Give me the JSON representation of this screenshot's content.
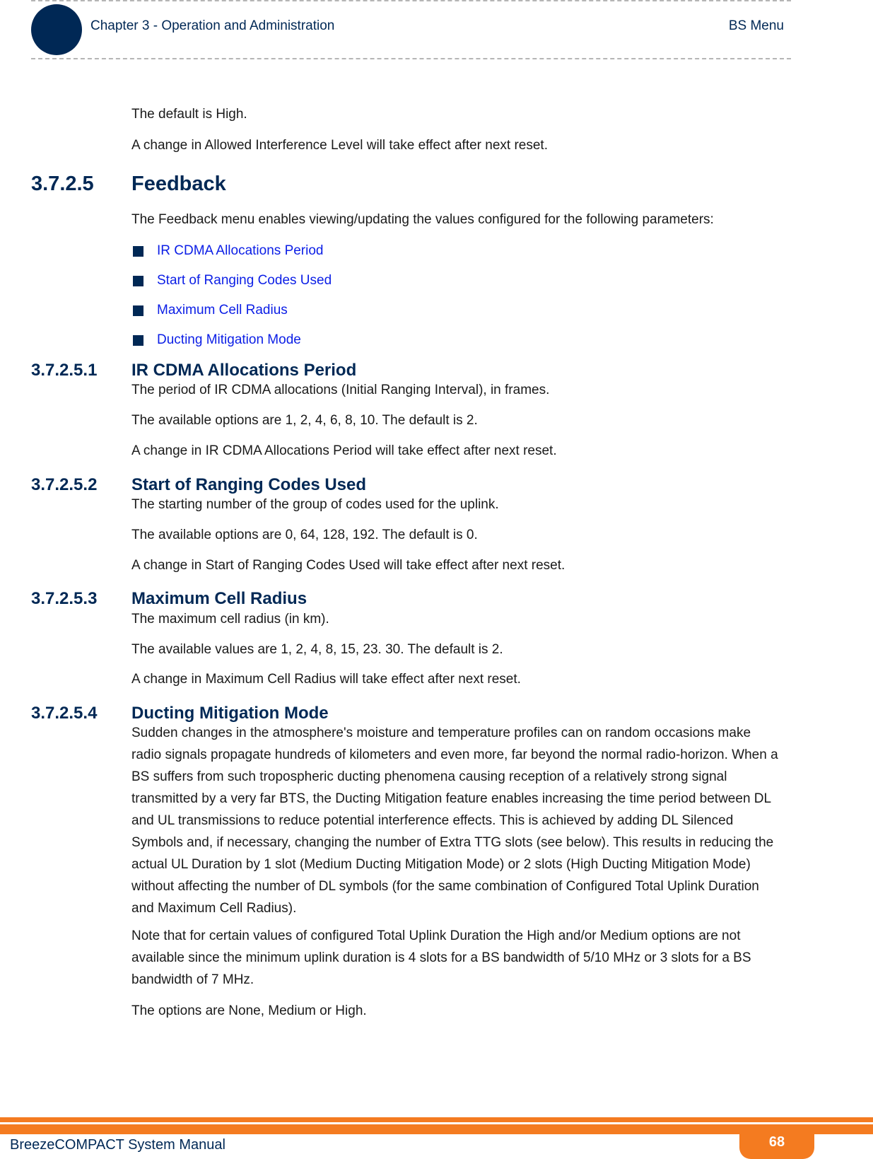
{
  "header": {
    "chapter": "Chapter 3 - Operation and Administration",
    "section": "BS Menu"
  },
  "intro": {
    "line1": "The default is High.",
    "line2": "A change in Allowed Interference Level will take effect after next reset."
  },
  "feedback": {
    "number": "3.7.2.5",
    "title": "Feedback",
    "description": "The Feedback menu enables viewing/updating the values configured for the following parameters:",
    "links": [
      "IR CDMA Allocations Period",
      "Start of Ranging Codes Used",
      "Maximum Cell Radius",
      "Ducting Mitigation Mode"
    ]
  },
  "subsections": [
    {
      "number": "3.7.2.5.1",
      "title": "IR CDMA Allocations Period",
      "lines": [
        "The period of IR CDMA allocations (Initial Ranging Interval), in frames.",
        "The available options are 1, 2, 4, 6, 8, 10. The default is 2.",
        "A change in IR CDMA Allocations Period will take effect after next reset."
      ]
    },
    {
      "number": "3.7.2.5.2",
      "title": "Start of Ranging Codes Used",
      "lines": [
        "The starting number of the group of codes used for the uplink.",
        "The available options are 0, 64, 128, 192. The default is 0.",
        "A change in Start of Ranging Codes Used will take effect after next reset."
      ]
    },
    {
      "number": "3.7.2.5.3",
      "title": "Maximum Cell Radius",
      "lines": [
        "The maximum cell radius (in km).",
        "The available values are 1, 2, 4, 8, 15, 23. 30. The default is 2.",
        "A change in Maximum Cell Radius will take effect after next reset."
      ]
    },
    {
      "number": "3.7.2.5.4",
      "title": "Ducting Mitigation Mode",
      "paragraphs": [
        "Sudden changes in the atmosphere's moisture and temperature profiles can on random occasions make radio signals propagate hundreds of kilometers and even more, far beyond the normal radio-horizon. When a BS suffers from such tropospheric ducting phenomena causing reception of a relatively strong signal transmitted by a very far BTS, the Ducting Mitigation feature enables increasing the time period between DL and UL transmissions to reduce potential interference effects. This is achieved by adding DL Silenced Symbols and, if necessary, changing the number of Extra TTG slots (see below). This results in reducing the actual UL Duration by 1 slot (Medium Ducting Mitigation Mode) or 2 slots (High Ducting Mitigation Mode) without affecting the number of DL symbols (for the same combination of Configured Total Uplink Duration and Maximum Cell Radius).",
        "Note that for certain values of configured Total Uplink Duration the High and/or Medium options are not available since the minimum uplink duration is 4 slots for a BS bandwidth of 5/10 MHz or 3 slots for a BS bandwidth of 7 MHz.",
        "The options are None, Medium or High."
      ]
    }
  ],
  "footer": {
    "title": "BreezeCOMPACT System Manual",
    "page": "68"
  }
}
